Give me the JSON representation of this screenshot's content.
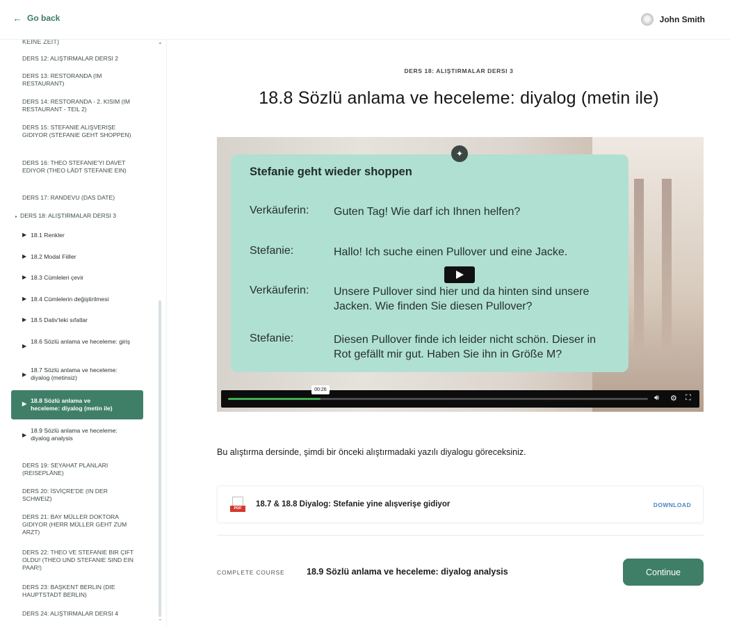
{
  "header": {
    "back_label": "Go back",
    "user_name": "John Smith"
  },
  "sidebar": {
    "top_partial": "KEINE ZEIT)",
    "lessons_before": [
      "DERS 12: ALIŞTIRMALAR DERSI 2",
      "DERS 13: RESTORANDA (IM RESTAURANT)",
      "DERS 14: RESTORANDA - 2. KISIM (IM RESTAURANT - TEIL 2)",
      "DERS 15: STEFANIE ALIŞVERIŞE GIDIYOR (STEFANIE GEHT SHOPPEN)",
      "DERS 16: THEO STEFANIE'YI DAVET EDIYOR (THEO LÄDT STEFANIE EIN)",
      "DERS 17: RANDEVU (DAS DATE)"
    ],
    "current_lesson": "DERS 18: ALIŞTIRMALAR DERSI 3",
    "sub_lessons": [
      "18.1 Renkler",
      "18.2 Modal Fiiller",
      "18.3 Cümleleri çevir",
      "18.4 Cümlelerin değiştirilmesi",
      "18.5 Dativ'teki sıfatlar",
      "18.6 Sözlü anlama ve heceleme: giriş",
      "18.7 Sözlü anlama ve heceleme: diyalog (metinsiz)",
      "18.8 Sözlü anlama ve heceleme: diyalog (metin ile)",
      "18.9 Sözlü anlama ve heceleme: diyalog analysis"
    ],
    "lessons_after": [
      "DERS 19: SEYAHAT PLANLARI (REISEPLÄNE)",
      "DERS 20: İSVİÇRE'DE (IN DER SCHWEIZ)",
      "DERS 21: BAY MÜLLER DOKTORA GIDIYOR (HERR MÜLLER GEHT ZUM ARZT)",
      "DERS 22: THEO VE STEFANIE BIR ÇIFT OLDU! (THEO UND STEFANIE SIND EIN PAAR!)",
      "DERS 23: BAŞKENT BERLIN (DIE HAUPTSTADT BERLIN)",
      "DERS 24: ALIŞTIRMALAR DERSI 4"
    ]
  },
  "main": {
    "breadcrumb": "DERS 18: ALIŞTIRMALAR DERSI 3",
    "title": "18.8 Sözlü anlama ve heceleme: diyalog (metin ile)",
    "video": {
      "card_title": "Stefanie geht wieder shoppen",
      "dialog": [
        {
          "speaker": "Verkäuferin:",
          "text": "Guten Tag! Wie darf ich Ihnen helfen?"
        },
        {
          "speaker": "Stefanie:",
          "text": "Hallo! Ich suche einen Pullover und eine Jacke."
        },
        {
          "speaker": "Verkäuferin:",
          "text": "Unsere Pullover sind hier und da hinten sind unsere Jacken. Wie finden Sie diesen Pullover?"
        },
        {
          "speaker": "Stefanie:",
          "text": "Diesen Pullover finde ich leider nicht schön. Dieser in Rot gefällt mir gut. Haben Sie ihn in Größe M?"
        }
      ],
      "current_time": "00:26",
      "progress": 0.22
    },
    "description": "Bu alıştırma dersinde, şimdi bir önceki alıştırmadaki yazılı diyalogu göreceksiniz.",
    "download": {
      "file_name": "18.7 & 18.8 Diyalog: Stefanie yine alışverişe gidiyor",
      "file_type": "PDF",
      "link_label": "DOWNLOAD"
    },
    "footer": {
      "complete_label": "COMPLETE COURSE",
      "next_lesson": "18.9 Sözlü anlama ve heceleme: diyalog analysis",
      "continue_label": "Continue"
    }
  },
  "colors": {
    "accent": "#3f7f68",
    "card": "#b0e0d2",
    "link": "#4d86c6",
    "pdf": "#d23a2e",
    "progress": "#3fae52"
  }
}
